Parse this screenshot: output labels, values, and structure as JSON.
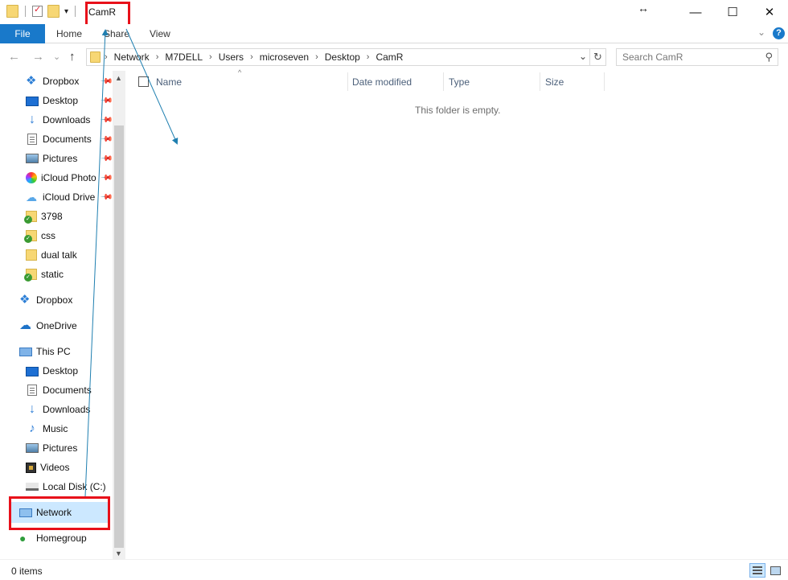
{
  "window": {
    "title": "CamR",
    "controls": {
      "minimize": "—",
      "maximize": "☐",
      "close": "✕"
    },
    "resize_glyph": "↔"
  },
  "ribbon": {
    "tabs": [
      {
        "label": "File",
        "active": true
      },
      {
        "label": "Home"
      },
      {
        "label": "Share"
      },
      {
        "label": "View"
      }
    ],
    "collapse_glyph": "⌄",
    "help_glyph": "?"
  },
  "navigation": {
    "back_glyph": "←",
    "forward_glyph": "→",
    "recent_glyph": "⌄",
    "up_glyph": "↑"
  },
  "address": {
    "crumbs": [
      "Network",
      "M7DELL",
      "Users",
      "microseven",
      "Desktop",
      "CamR"
    ],
    "separator": "›",
    "dropdown_glyph": "⌄",
    "refresh_glyph": "↻"
  },
  "search": {
    "placeholder": "Search CamR",
    "icon_glyph": "⚲"
  },
  "nav_pane": {
    "pin_glyph": "📌",
    "items": [
      {
        "label": "Dropbox",
        "icon": "dropbox-icon",
        "pinned": true
      },
      {
        "label": "Desktop",
        "icon": "desktop-icon",
        "pinned": true
      },
      {
        "label": "Downloads",
        "icon": "downloads-icon",
        "pinned": true
      },
      {
        "label": "Documents",
        "icon": "documents-icon",
        "pinned": true
      },
      {
        "label": "Pictures",
        "icon": "pictures-icon",
        "pinned": true
      },
      {
        "label": "iCloud Photo",
        "icon": "icloud-photos-icon",
        "pinned": true
      },
      {
        "label": "iCloud Drive",
        "icon": "icloud-drive-icon",
        "pinned": true
      },
      {
        "label": "3798",
        "icon": "folder-sync-icon"
      },
      {
        "label": "css",
        "icon": "folder-sync-icon"
      },
      {
        "label": "dual talk",
        "icon": "folder-icon"
      },
      {
        "label": "static",
        "icon": "folder-sync-icon"
      },
      {
        "label": "Dropbox",
        "icon": "dropbox-icon"
      },
      {
        "label": "OneDrive",
        "icon": "onedrive-icon"
      },
      {
        "label": "This PC",
        "icon": "this-pc-icon"
      },
      {
        "label": "Desktop",
        "icon": "desktop-icon"
      },
      {
        "label": "Documents",
        "icon": "documents-icon"
      },
      {
        "label": "Downloads",
        "icon": "downloads-icon"
      },
      {
        "label": "Music",
        "icon": "music-icon"
      },
      {
        "label": "Pictures",
        "icon": "pictures-icon"
      },
      {
        "label": "Videos",
        "icon": "videos-icon"
      },
      {
        "label": "Local Disk (C:)",
        "icon": "local-disk-icon"
      },
      {
        "label": "Network",
        "icon": "network-icon",
        "selected": true
      },
      {
        "label": "Homegroup",
        "icon": "homegroup-icon"
      }
    ],
    "scroll_up_glyph": "▲",
    "scroll_down_glyph": "▼"
  },
  "file_list": {
    "columns": [
      "Name",
      "Date modified",
      "Type",
      "Size"
    ],
    "sort_glyph": "^",
    "empty_message": "This folder is empty."
  },
  "status_bar": {
    "item_count": "0 items"
  },
  "annotation": {
    "highlight_color": "#e8101a",
    "arrow_color": "#1f7fb0"
  }
}
